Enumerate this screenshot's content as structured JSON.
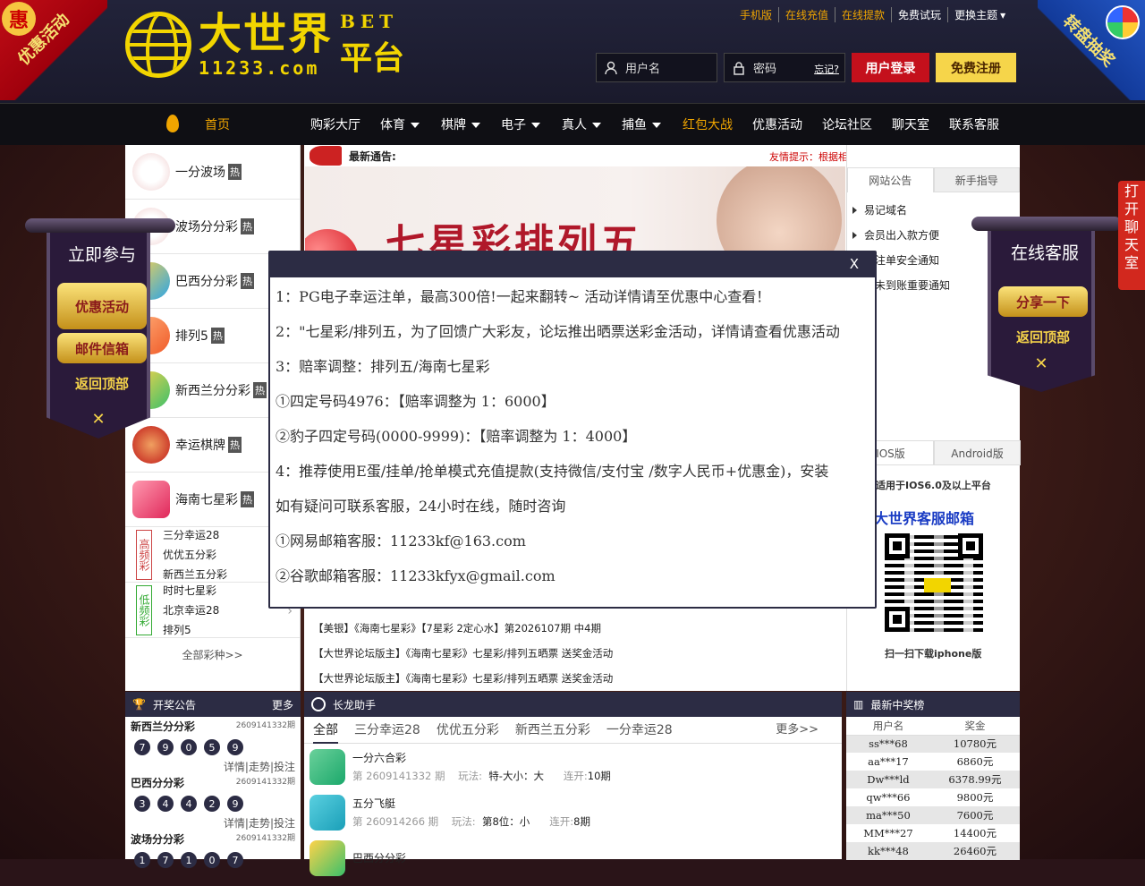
{
  "header": {
    "logo_cn": "大世界",
    "logo_url": "11233.com",
    "logo_bet": "BET",
    "logo_platform": "平台",
    "ribbon_left": "优惠活动",
    "ribbon_left_seal": "惠",
    "ribbon_right": "转盘抽奖",
    "toplinks": [
      "手机版",
      "在线充值",
      "在线提款",
      "免费试玩",
      "更换主题"
    ],
    "username_placeholder": "用户名",
    "password_placeholder": "密码",
    "forgot": "忘记?",
    "login_btn": "用户登录",
    "register_btn": "免费注册"
  },
  "nav": {
    "home": "首页",
    "items": [
      "购彩大厅",
      "体育",
      "棋牌",
      "电子",
      "真人",
      "捕鱼",
      "红包大战",
      "优惠活动",
      "论坛社区",
      "聊天室",
      "联系客服"
    ]
  },
  "left_lotteries": [
    {
      "name": "一分波场",
      "hot": "热"
    },
    {
      "name": "波场分分彩",
      "hot": "热"
    },
    {
      "name": "巴西分分彩",
      "hot": "热"
    },
    {
      "name": "排列5",
      "hot": "热"
    },
    {
      "name": "新西兰分分彩",
      "hot": "热"
    },
    {
      "name": "幸运棋牌",
      "hot": "热"
    },
    {
      "name": "海南七星彩",
      "hot": "热"
    }
  ],
  "high_freq": {
    "tag": "高频彩",
    "items": [
      "三分幸运28",
      "优优五分彩",
      "新西兰五分彩"
    ]
  },
  "low_freq": {
    "tag": "低频彩",
    "items": [
      "时时七星彩",
      "北京幸运28",
      "排列5"
    ]
  },
  "all_kinds": "全部彩种>>",
  "notice": {
    "label": "最新通告:",
    "tip": "友情提示：根据相关会员反应，因在诈骗网站贪图小利"
  },
  "banner_title": "七星彩排列五",
  "site_tabs": [
    "网站公告",
    "新手指导"
  ],
  "announcements": [
    "易记域名",
    "会员出入款方便",
    "下注单安全通知",
    "值未到账重要通知"
  ],
  "app_tabs": [
    "IOS版",
    "Android版"
  ],
  "app_desc": "适用于IOS6.0及以上平台",
  "mail_title": "大世界客服邮箱",
  "scan_text": "扫一扫下载iphone版",
  "news": [
    "【美银】《海南七星彩》【7星彩 2定心水】第2026107期 中4期",
    "【大世界论坛版主】《海南七星彩》七星彩/排列五晒票 送奖金活动",
    "【大世界论坛版主】《海南七星彩》七星彩/排列五晒票 送奖金活动"
  ],
  "draw_panel": {
    "title": "开奖公告",
    "more": "更多",
    "draws": [
      {
        "name": "新西兰分分彩",
        "issue": "2609141332期",
        "balls": [
          "7",
          "9",
          "0",
          "5",
          "9"
        ],
        "links": "详情|走势|投注"
      },
      {
        "name": "巴西分分彩",
        "issue": "2609141332期",
        "balls": [
          "3",
          "4",
          "4",
          "2",
          "9"
        ],
        "links": "详情|走势|投注"
      },
      {
        "name": "波场分分彩",
        "issue": "2609141332期",
        "balls": [
          "1",
          "7",
          "1",
          "0",
          "7"
        ],
        "links": ""
      }
    ]
  },
  "long_panel": {
    "title": "长龙助手",
    "tabs": [
      "全部",
      "三分幸运28",
      "优优五分彩",
      "新西兰五分彩",
      "一分幸运28"
    ],
    "more": "更多>>",
    "rows": [
      {
        "name": "一分六合彩",
        "issue": "第 2609141332 期",
        "play_label": "玩法:",
        "play": "特-大小：大",
        "streak_label": "连开:",
        "streak": "10期"
      },
      {
        "name": "五分飞艇",
        "issue": "第 260914266 期",
        "play_label": "玩法:",
        "play": "第8位：小",
        "streak_label": "连开:",
        "streak": "8期"
      },
      {
        "name": "巴西分分彩",
        "issue": "",
        "play_label": "",
        "play": "",
        "streak_label": "",
        "streak": ""
      }
    ]
  },
  "win_panel": {
    "title": "最新中奖榜",
    "headers": [
      "用户名",
      "奖金"
    ],
    "rows": [
      [
        "ss***68",
        "10780元"
      ],
      [
        "aa***17",
        "6860元"
      ],
      [
        "Dw***ld",
        "6378.99元"
      ],
      [
        "qw***66",
        "9800元"
      ],
      [
        "ma***50",
        "7600元"
      ],
      [
        "MM***27",
        "14400元"
      ],
      [
        "kk***48",
        "26460元"
      ]
    ]
  },
  "float_left": {
    "title": "立即参与",
    "btn1": "优惠活动",
    "btn2": "邮件信箱",
    "top": "返回顶部",
    "close": "✕"
  },
  "float_right": {
    "title": "在线客服",
    "share": "分享一下",
    "top": "返回顶部",
    "close": "✕"
  },
  "chatbar": "打开聊天室",
  "modal": {
    "close": "X",
    "lines": [
      "1：PG电子幸运注单，最高300倍!一起来翻转~ 活动详情请至优惠中心查看！",
      "2：\"七星彩/排列五，为了回馈广大彩友，论坛推出晒票送彩金活动，详情请查看优惠活动",
      "3：赔率调整：排列五/海南七星彩",
      "①四定号码4976：【赔率调整为 1：6000】",
      "②豹子四定号码(0000-9999)：【赔率调整为 1：4000】",
      "4：推荐使用E蛋/挂单/抢单模式充值提款(支持微信/支付宝 /数字人民币+优惠金)，安装",
      "如有疑问可联系客服，24小时在线，随时咨询",
      "①网易邮箱客服：11233kf@163.com",
      "②谷歌邮箱客服：11233kfyx@gmail.com"
    ]
  }
}
